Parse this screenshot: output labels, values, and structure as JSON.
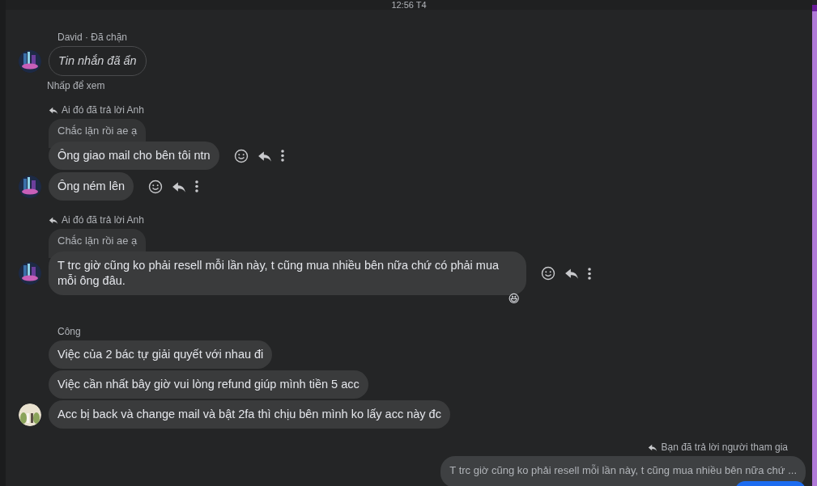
{
  "timestamp": "12:56 T4",
  "groups": [
    {
      "outgoing": false,
      "sender": "David · Đã chặn",
      "items": [
        {
          "kind": "hidden",
          "text": "Tin nhắn đã ẩn",
          "hint": "Nhấp để xem",
          "actions": false
        }
      ]
    },
    {
      "outgoing": false,
      "reply_header": "Ai đó đã trả lời Anh",
      "quote": "Chắc lặn rồi ae ạ",
      "items": [
        {
          "kind": "text",
          "text": "Ông giao mail cho bên tôi ntn",
          "actions": true
        },
        {
          "kind": "text",
          "text": "Ông ném lên",
          "actions": true
        }
      ]
    },
    {
      "outgoing": false,
      "reply_header": "Ai đó đã trả lời Anh",
      "quote": "Chắc lặn rồi ae ạ",
      "items": [
        {
          "kind": "text",
          "text": "T trc giờ cũng ko phải resell mỗi lần này, t cũng mua nhiều bên nữa chứ có phải mua mỗi ông đâu.",
          "actions": true,
          "reaction": "😆"
        }
      ]
    },
    {
      "outgoing": false,
      "sender": "Công",
      "items": [
        {
          "kind": "text",
          "text": "Việc của 2 bác tự giải quyết với nhau đi",
          "actions": false
        },
        {
          "kind": "text",
          "text": "Việc cần nhất bây giờ vui lòng refund giúp mình tiền 5 acc",
          "actions": false
        },
        {
          "kind": "text",
          "text": "Acc bị back và change mail và bật 2fa thì chịu bên mình ko lấy acc này đc",
          "actions": false
        }
      ]
    },
    {
      "outgoing": true,
      "reply_header": "Bạn đã trả lời người tham gia",
      "quote": "T trc giờ cũng ko phải resell mỗi lần này, t cũng mua nhiều bên nữa chứ ...",
      "items": [
        {
          "kind": "partial",
          "actions": false
        }
      ]
    }
  ]
}
